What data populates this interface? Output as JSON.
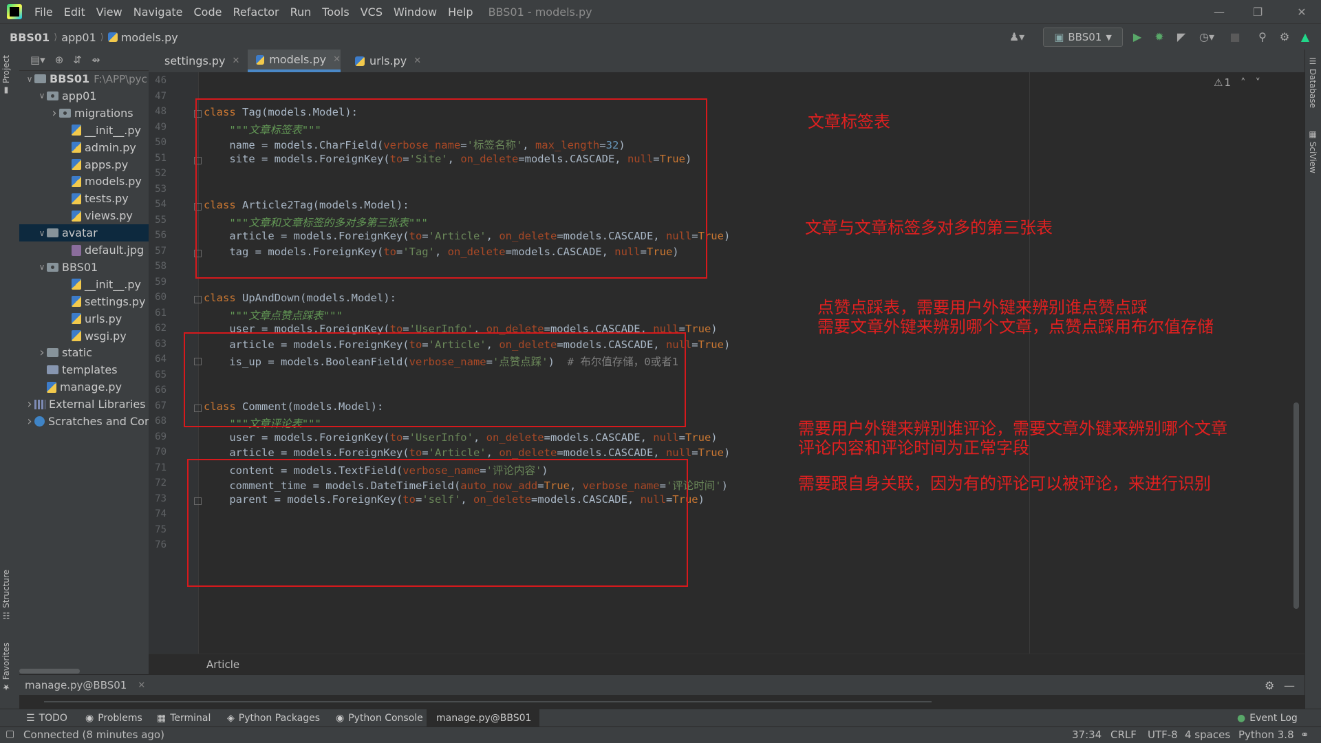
{
  "menu": [
    "File",
    "Edit",
    "View",
    "Navigate",
    "Code",
    "Refactor",
    "Run",
    "Tools",
    "VCS",
    "Window",
    "Help"
  ],
  "window_title": "BBS01 - models.py",
  "breadcrumb": [
    "BBS01",
    "app01",
    "models.py"
  ],
  "run_config": "BBS01",
  "project_tree": [
    {
      "label": "BBS01",
      "extra": "F:\\APP\\pyc",
      "depth": 0,
      "arrow": "v",
      "icon": "folder"
    },
    {
      "label": "app01",
      "depth": 1,
      "arrow": "v",
      "icon": "package"
    },
    {
      "label": "migrations",
      "depth": 2,
      "arrow": ">",
      "icon": "package"
    },
    {
      "label": "__init__.py",
      "depth": 3,
      "icon": "py"
    },
    {
      "label": "admin.py",
      "depth": 3,
      "icon": "py"
    },
    {
      "label": "apps.py",
      "depth": 3,
      "icon": "py"
    },
    {
      "label": "models.py",
      "depth": 3,
      "icon": "py"
    },
    {
      "label": "tests.py",
      "depth": 3,
      "icon": "py"
    },
    {
      "label": "views.py",
      "depth": 3,
      "icon": "py"
    },
    {
      "label": "avatar",
      "depth": 1,
      "arrow": "v",
      "icon": "folder",
      "selected": true
    },
    {
      "label": "default.jpg",
      "depth": 3,
      "icon": "img"
    },
    {
      "label": "BBS01",
      "depth": 1,
      "arrow": "v",
      "icon": "package"
    },
    {
      "label": "__init__.py",
      "depth": 3,
      "icon": "py"
    },
    {
      "label": "settings.py",
      "depth": 3,
      "icon": "py"
    },
    {
      "label": "urls.py",
      "depth": 3,
      "icon": "py"
    },
    {
      "label": "wsgi.py",
      "depth": 3,
      "icon": "py"
    },
    {
      "label": "static",
      "depth": 1,
      "arrow": ">",
      "icon": "folder"
    },
    {
      "label": "templates",
      "depth": 1,
      "icon": "folder-blue"
    },
    {
      "label": "manage.py",
      "depth": 1,
      "icon": "py"
    },
    {
      "label": "External Libraries",
      "depth": 0,
      "arrow": ">",
      "icon": "lib"
    },
    {
      "label": "Scratches and Con",
      "depth": 0,
      "arrow": ">",
      "icon": "scratch"
    }
  ],
  "editor_tabs": [
    {
      "label": "settings.py",
      "active": false
    },
    {
      "label": "models.py",
      "active": true
    },
    {
      "label": "urls.py",
      "active": false
    }
  ],
  "line_numbers": [
    "46",
    "47",
    "48",
    "49",
    "50",
    "51",
    "52",
    "53",
    "54",
    "55",
    "56",
    "57",
    "58",
    "59",
    "60",
    "61",
    "62",
    "63",
    "64",
    "65",
    "66",
    "67",
    "68",
    "69",
    "70",
    "71",
    "72",
    "73",
    "74",
    "75",
    "76"
  ],
  "code": [
    {
      "ln": 48,
      "parts": [
        [
          "kw",
          "class "
        ],
        [
          "",
          "Tag(models.Model):"
        ]
      ]
    },
    {
      "ln": 49,
      "parts": [
        [
          "doc",
          "    \"\"\"文章标签表\"\"\""
        ]
      ]
    },
    {
      "ln": 50,
      "parts": [
        [
          "",
          "    name = models.CharField("
        ],
        [
          "param",
          "verbose_name"
        ],
        [
          "",
          "="
        ],
        [
          "str",
          "'标签名称'"
        ],
        [
          "",
          ", "
        ],
        [
          "param",
          "max_length"
        ],
        [
          "",
          "="
        ],
        [
          "num",
          "32"
        ],
        [
          "",
          ")"
        ]
      ]
    },
    {
      "ln": 51,
      "parts": [
        [
          "",
          "    site = models.ForeignKey("
        ],
        [
          "param",
          "to"
        ],
        [
          "",
          "="
        ],
        [
          "str",
          "'Site'"
        ],
        [
          "",
          ", "
        ],
        [
          "param",
          "on_delete"
        ],
        [
          "",
          "=models.CASCADE, "
        ],
        [
          "param",
          "null"
        ],
        [
          "",
          "="
        ],
        [
          "kw",
          "True"
        ],
        [
          "",
          ")"
        ]
      ]
    },
    {
      "ln": 54,
      "parts": [
        [
          "kw",
          "class "
        ],
        [
          "",
          "Article2Tag(models.Model):"
        ]
      ]
    },
    {
      "ln": 55,
      "parts": [
        [
          "doc",
          "    \"\"\"文章和文章标签的多对多第三张表\"\"\""
        ]
      ]
    },
    {
      "ln": 56,
      "parts": [
        [
          "",
          "    article = models.ForeignKey("
        ],
        [
          "param",
          "to"
        ],
        [
          "",
          "="
        ],
        [
          "str",
          "'Article'"
        ],
        [
          "",
          ", "
        ],
        [
          "param",
          "on_delete"
        ],
        [
          "",
          "=models.CASCADE, "
        ],
        [
          "param",
          "null"
        ],
        [
          "",
          "="
        ],
        [
          "kw",
          "True"
        ],
        [
          "",
          ")"
        ]
      ]
    },
    {
      "ln": 57,
      "parts": [
        [
          "",
          "    tag = models.ForeignKey("
        ],
        [
          "param",
          "to"
        ],
        [
          "",
          "="
        ],
        [
          "str",
          "'Tag'"
        ],
        [
          "",
          ", "
        ],
        [
          "param",
          "on_delete"
        ],
        [
          "",
          "=models.CASCADE, "
        ],
        [
          "param",
          "null"
        ],
        [
          "",
          "="
        ],
        [
          "kw",
          "True"
        ],
        [
          "",
          ")"
        ]
      ]
    },
    {
      "ln": 60,
      "parts": [
        [
          "kw",
          "class "
        ],
        [
          "",
          "UpAndDown(models.Model):"
        ]
      ]
    },
    {
      "ln": 61,
      "parts": [
        [
          "doc",
          "    \"\"\"文章点赞点踩表\"\"\""
        ]
      ]
    },
    {
      "ln": 62,
      "parts": [
        [
          "",
          "    user = models.ForeignKey("
        ],
        [
          "param",
          "to"
        ],
        [
          "",
          "="
        ],
        [
          "str",
          "'UserInfo'"
        ],
        [
          "",
          ", "
        ],
        [
          "param",
          "on_delete"
        ],
        [
          "",
          "=models.CASCADE, "
        ],
        [
          "param",
          "null"
        ],
        [
          "",
          "="
        ],
        [
          "kw",
          "True"
        ],
        [
          "",
          ")"
        ]
      ]
    },
    {
      "ln": 63,
      "parts": [
        [
          "",
          "    article = models.ForeignKey("
        ],
        [
          "param",
          "to"
        ],
        [
          "",
          "="
        ],
        [
          "str",
          "'Article'"
        ],
        [
          "",
          ", "
        ],
        [
          "param",
          "on_delete"
        ],
        [
          "",
          "=models.CASCADE, "
        ],
        [
          "param",
          "null"
        ],
        [
          "",
          "="
        ],
        [
          "kw",
          "True"
        ],
        [
          "",
          ")"
        ]
      ]
    },
    {
      "ln": 64,
      "parts": [
        [
          "",
          "    is_up = models.BooleanField("
        ],
        [
          "param",
          "verbose_name"
        ],
        [
          "",
          "="
        ],
        [
          "str",
          "'点赞点踩'"
        ],
        [
          "",
          ")  "
        ],
        [
          "cmt",
          "# 布尔值存储，0或者1"
        ]
      ]
    },
    {
      "ln": 67,
      "parts": [
        [
          "kw",
          "class "
        ],
        [
          "",
          "Comment(models.Model):"
        ]
      ]
    },
    {
      "ln": 68,
      "parts": [
        [
          "doc",
          "    \"\"\"文章评论表\"\"\""
        ]
      ]
    },
    {
      "ln": 69,
      "parts": [
        [
          "",
          "    user = models.ForeignKey("
        ],
        [
          "param",
          "to"
        ],
        [
          "",
          "="
        ],
        [
          "str",
          "'UserInfo'"
        ],
        [
          "",
          ", "
        ],
        [
          "param",
          "on_delete"
        ],
        [
          "",
          "=models.CASCADE, "
        ],
        [
          "param",
          "null"
        ],
        [
          "",
          "="
        ],
        [
          "kw",
          "True"
        ],
        [
          "",
          ")"
        ]
      ]
    },
    {
      "ln": 70,
      "parts": [
        [
          "",
          "    article = models.ForeignKey("
        ],
        [
          "param",
          "to"
        ],
        [
          "",
          "="
        ],
        [
          "str",
          "'Article'"
        ],
        [
          "",
          ", "
        ],
        [
          "param",
          "on_delete"
        ],
        [
          "",
          "=models.CASCADE, "
        ],
        [
          "param",
          "null"
        ],
        [
          "",
          "="
        ],
        [
          "kw",
          "True"
        ],
        [
          "",
          ")"
        ]
      ]
    },
    {
      "ln": 71,
      "parts": [
        [
          "",
          "    content = models.TextField("
        ],
        [
          "param",
          "verbose_name"
        ],
        [
          "",
          "="
        ],
        [
          "str",
          "'评论内容'"
        ],
        [
          "",
          ")"
        ]
      ]
    },
    {
      "ln": 72,
      "parts": [
        [
          "",
          "    comment_time = models.DateTimeField("
        ],
        [
          "param",
          "auto_now_add"
        ],
        [
          "",
          "="
        ],
        [
          "kw",
          "True"
        ],
        [
          "",
          ", "
        ],
        [
          "param",
          "verbose_name"
        ],
        [
          "",
          "="
        ],
        [
          "str",
          "'评论时间'"
        ],
        [
          "",
          ")"
        ]
      ]
    },
    {
      "ln": 73,
      "parts": [
        [
          "",
          "    parent = models.ForeignKey("
        ],
        [
          "param",
          "to"
        ],
        [
          "",
          "="
        ],
        [
          "str",
          "'self'"
        ],
        [
          "",
          ", "
        ],
        [
          "param",
          "on_delete"
        ],
        [
          "",
          "=models.CASCADE, "
        ],
        [
          "param",
          "null"
        ],
        [
          "",
          "="
        ],
        [
          "kw",
          "True"
        ],
        [
          "",
          ")"
        ]
      ]
    }
  ],
  "annotations": {
    "tag": "文章标签表",
    "article2tag": "文章与文章标签多对多的第三张表",
    "updown_1": "点赞点踩表，需要用户外键来辨别谁点赞点踩",
    "updown_2": "需要文章外键来辨别哪个文章，点赞点踩用布尔值存储",
    "comment_1": "需要用户外键来辨别谁评论，需要文章外键来辨别哪个文章",
    "comment_2": "评论内容和评论时间为正常字段",
    "comment_3": "需要跟自身关联，因为有的评论可以被评论，来进行识别"
  },
  "inspection_count": "1",
  "code_breadcrumb": "Article",
  "run_panel": {
    "tab_label": "manage.py@BBS01"
  },
  "bottom_tabs": [
    "TODO",
    "Problems",
    "Terminal",
    "Python Packages",
    "Python Console",
    "manage.py@BBS01"
  ],
  "event_log": "Event Log",
  "side_tabs": {
    "project": "Project",
    "structure": "Structure",
    "favorites": "Favorites",
    "database": "Database",
    "sciview": "SciView"
  },
  "status": {
    "left": "Connected (8 minutes ago)",
    "position": "37:34",
    "line_ending": "CRLF",
    "encoding": "UTF-8",
    "indent": "4 spaces",
    "interpreter": "Python 3.8"
  },
  "colors": {
    "annotation": "#e02020",
    "keyword": "#cc7832",
    "string": "#6a8759",
    "param": "#aa4926",
    "docstring": "#629755",
    "accent": "#4a88c7"
  }
}
